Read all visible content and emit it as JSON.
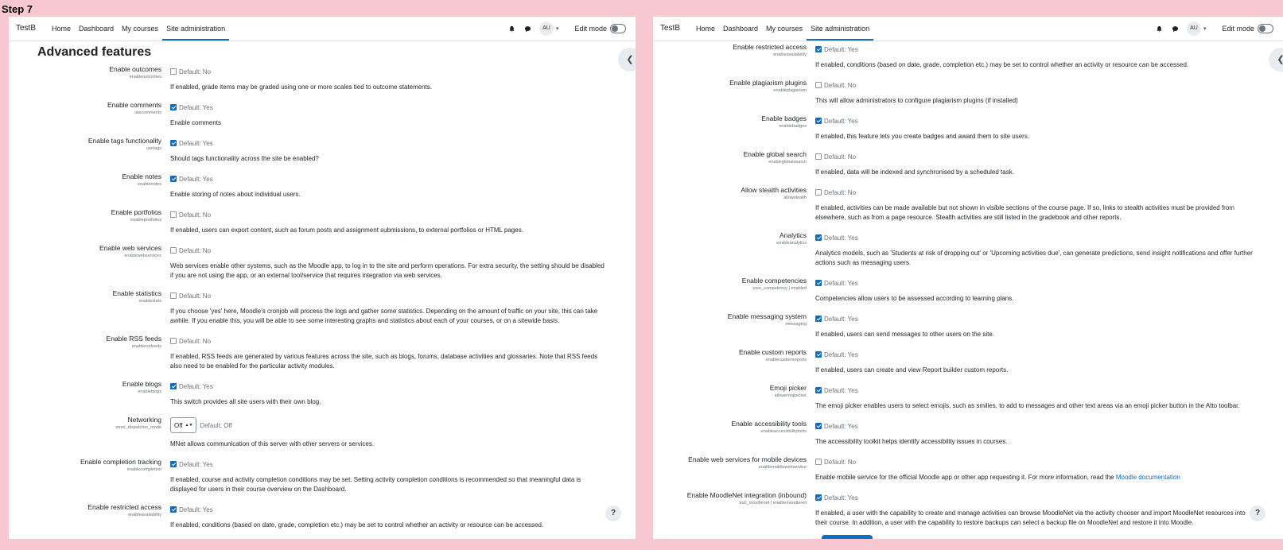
{
  "step_title": "Step 7",
  "nav": {
    "brand": "TestB",
    "links": [
      "Home",
      "Dashboard",
      "My courses",
      "Site administration"
    ],
    "avatar_initials": "AU",
    "edit_mode_label": "Edit mode"
  },
  "icons": {
    "bell": "bell-icon",
    "messages": "chat-icon",
    "drawer": "chevron-left-icon",
    "help": "question-icon"
  },
  "colors": {
    "accent": "#0f6cbf",
    "page_background": "#f6c9d2"
  },
  "left_panel": {
    "heading": "Advanced features",
    "settings": [
      {
        "label": "Enable outcomes",
        "key": "enableoutcomes",
        "checked": false,
        "default": "Default: No",
        "desc": "If enabled, grade items may be graded using one or more scales tied to outcome statements."
      },
      {
        "label": "Enable comments",
        "key": "usecomments",
        "checked": true,
        "default": "Default: Yes",
        "desc": "Enable comments"
      },
      {
        "label": "Enable tags functionality",
        "key": "usetags",
        "checked": true,
        "default": "Default: Yes",
        "desc": "Should tags functionality across the site be enabled?"
      },
      {
        "label": "Enable notes",
        "key": "enablenotes",
        "checked": true,
        "default": "Default: Yes",
        "desc": "Enable storing of notes about individual users."
      },
      {
        "label": "Enable portfolios",
        "key": "enableportfolios",
        "checked": false,
        "default": "Default: No",
        "desc": "If enabled, users can export content, such as forum posts and assignment submissions, to external portfolios or HTML pages."
      },
      {
        "label": "Enable web services",
        "key": "enablewebservices",
        "checked": false,
        "default": "Default: No",
        "desc": "Web services enable other systems, such as the Moodle app, to log in to the site and perform operations. For extra security, the setting should be disabled if you are not using the app, or an external tool/service that requires integration via web services."
      },
      {
        "label": "Enable statistics",
        "key": "enablestats",
        "checked": false,
        "default": "Default: No",
        "desc": "If you choose 'yes' here, Moodle's cronjob will process the logs and gather some statistics. Depending on the amount of traffic on your site, this can take awhile. If you enable this, you will be able to see some interesting graphs and statistics about each of your courses, or on a sitewide basis."
      },
      {
        "label": "Enable RSS feeds",
        "key": "enablerssfeeds",
        "checked": false,
        "default": "Default: No",
        "desc": "If enabled, RSS feeds are generated by various features across the site, such as blogs, forums, database activities and glossaries. Note that RSS feeds also need to be enabled for the particular activity modules."
      },
      {
        "label": "Enable blogs",
        "key": "enableblogs",
        "checked": true,
        "default": "Default: Yes",
        "desc": "This switch provides all site users with their own blog."
      }
    ],
    "networking": {
      "label": "Networking",
      "key": "mnet_dispatcher_mode",
      "value": "Off",
      "default": "Default: Off",
      "desc": "MNet allows communication of this server with other servers or services."
    },
    "settings_after": [
      {
        "label": "Enable completion tracking",
        "key": "enablecompletion",
        "checked": true,
        "default": "Default: Yes",
        "desc": "If enabled, course and activity completion conditions may be set. Setting activity completion conditions is recommended so that meaningful data is displayed for users in their course overview on the Dashboard."
      },
      {
        "label": "Enable restricted access",
        "key": "enableavailability",
        "checked": true,
        "default": "Default: Yes",
        "desc": "If enabled, conditions (based on date, grade, completion etc.) may be set to control whether an activity or resource can be accessed."
      },
      {
        "label": "Enable plagiarism plugins",
        "key": "enableplagiarism",
        "checked": false,
        "default": "Default: No",
        "desc": "This will allow administrators to configure plagiarism plugins (if installed)"
      }
    ]
  },
  "right_panel": {
    "settings": [
      {
        "label": "Enable restricted access",
        "key": "enableavailability",
        "checked": true,
        "default": "Default: Yes",
        "desc": "If enabled, conditions (based on date, grade, completion etc.) may be set to control whether an activity or resource can be accessed."
      },
      {
        "label": "Enable plagiarism plugins",
        "key": "enableplagiarism",
        "checked": false,
        "default": "Default: No",
        "desc": "This will allow administrators to configure plagiarism plugins (if installed)"
      },
      {
        "label": "Enable badges",
        "key": "enablebadges",
        "checked": true,
        "default": "Default: Yes",
        "desc": "If enabled, this feature lets you create badges and award them to site users."
      },
      {
        "label": "Enable global search",
        "key": "enableglobalsearch",
        "checked": false,
        "default": "Default: No",
        "desc": "If enabled, data will be indexed and synchronised by a scheduled task."
      },
      {
        "label": "Allow stealth activities",
        "key": "allowstealth",
        "checked": false,
        "default": "Default: No",
        "desc": "If enabled, activities can be made available but not shown in visible sections of the course page. If so, links to stealth activities must be provided from elsewhere, such as from a page resource. Stealth activities are still listed in the gradebook and other reports."
      },
      {
        "label": "Analytics",
        "key": "enableanalytics",
        "checked": true,
        "default": "Default: Yes",
        "desc": "Analytics models, such as 'Students at risk of dropping out' or 'Upcoming activities due', can generate predictions, send insight notifications and offer further actions such as messaging users."
      },
      {
        "label": "Enable competencies",
        "key": "core_competency | enabled",
        "checked": true,
        "default": "Default: Yes",
        "desc": "Competencies allow users to be assessed according to learning plans."
      },
      {
        "label": "Enable messaging system",
        "key": "messaging",
        "checked": true,
        "default": "Default: Yes",
        "desc": "If enabled, users can send messages to other users on the site."
      },
      {
        "label": "Enable custom reports",
        "key": "enablecustomreports",
        "checked": true,
        "default": "Default: Yes",
        "desc": "If enabled, users can create and view Report builder custom reports."
      },
      {
        "label": "Emoji picker",
        "key": "allowemojipicker",
        "checked": true,
        "default": "Default: Yes",
        "desc": "The emoji picker enables users to select emojis, such as smilies, to add to messages and other text areas via an emoji picker button in the Atto toolbar."
      },
      {
        "label": "Enable accessibility tools",
        "key": "enableaccessibilitytools",
        "checked": true,
        "default": "Default: Yes",
        "desc": "The accessibility toolkit helps identify accessibility issues in courses."
      }
    ],
    "mobile": {
      "label": "Enable web services for mobile devices",
      "key": "enablemobilewebservice",
      "checked": false,
      "default": "Default: No",
      "desc_prefix": "Enable mobile service for the official Moodle app or other app requesting it. For more information, read the ",
      "desc_link": "Moodle documentation"
    },
    "moodlenet": {
      "label": "Enable MoodleNet integration (inbound)",
      "key": "tool_moodlenet | enablemoodlenet",
      "checked": true,
      "default": "Default: Yes",
      "desc": "If enabled, a user with the capability to create and manage activities can browse MoodleNet via the activity chooser and import MoodleNet resources into their course. In addition, a user with the capability to restore backups can select a backup file on MoodleNet and restore it into Moodle."
    }
  }
}
